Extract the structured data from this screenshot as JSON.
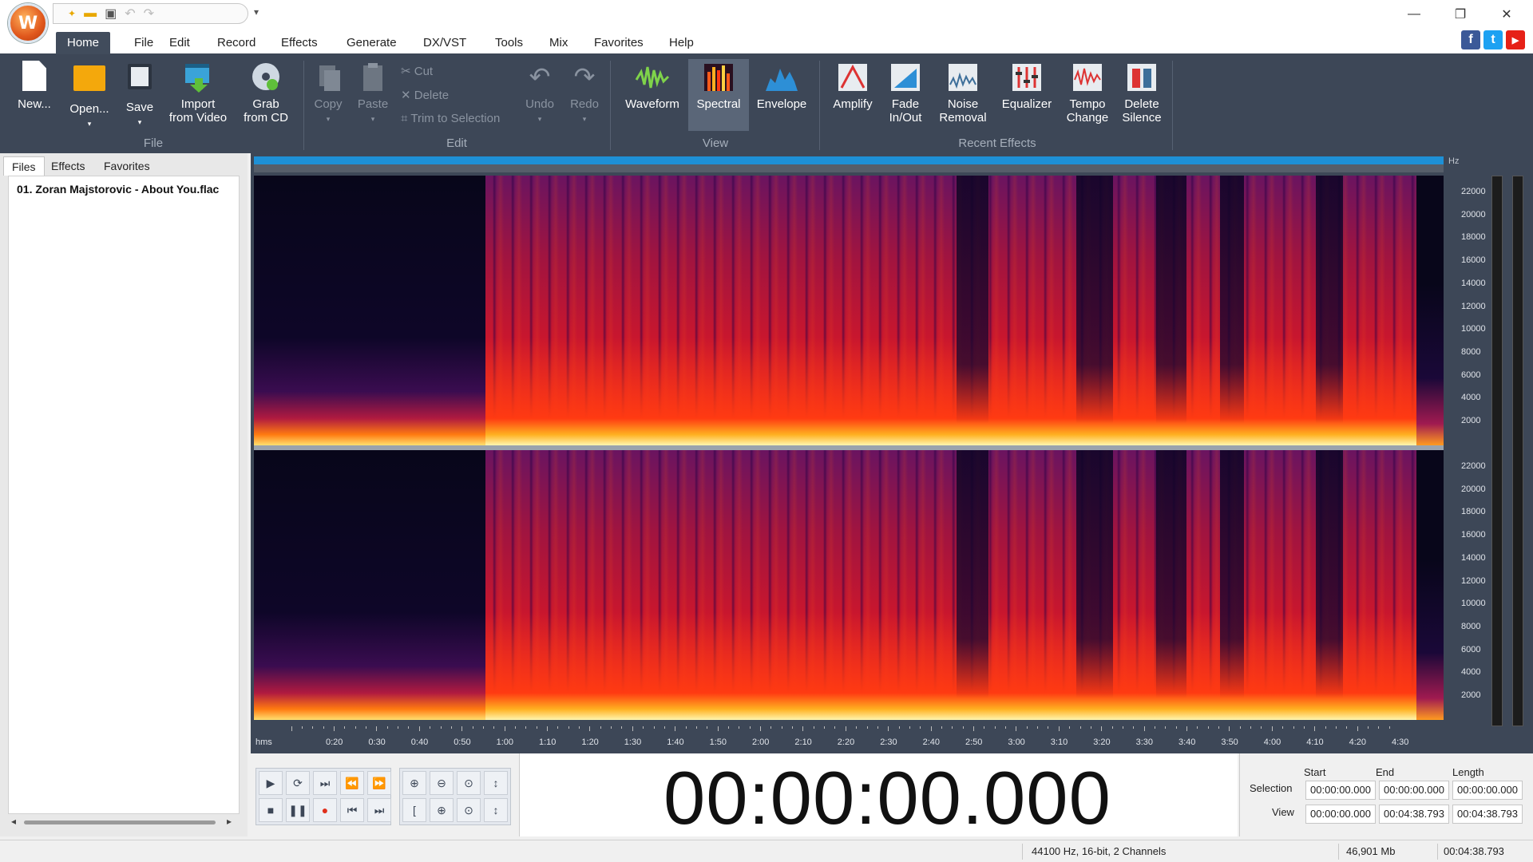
{
  "app": {
    "logo_glyph": "W"
  },
  "quick_access": {
    "new_icon": "new-doc-icon",
    "open_icon": "folder-icon",
    "save_icon": "floppy-icon",
    "undo_icon": "undo-icon",
    "redo_icon": "redo-icon"
  },
  "window_controls": {
    "minimize": "—",
    "restore": "❐",
    "close": "✕"
  },
  "menu": {
    "tabs": [
      "Home",
      "File",
      "Edit",
      "Record",
      "Effects",
      "Generate",
      "DX/VST",
      "Tools",
      "Mix",
      "Favorites",
      "Help"
    ],
    "active": "Home"
  },
  "social": {
    "facebook": "f",
    "twitter": "t",
    "youtube": "▶"
  },
  "ribbon": {
    "file_group": {
      "label": "File",
      "new": "New...",
      "open": "Open...",
      "save": "Save",
      "import_line1": "Import",
      "import_line2": "from Video",
      "grab_line1": "Grab",
      "grab_line2": "from CD"
    },
    "edit_group": {
      "label": "Edit",
      "copy": "Copy",
      "paste": "Paste",
      "cut": "Cut",
      "delete": "Delete",
      "trim": "Trim to Selection",
      "undo": "Undo",
      "redo": "Redo"
    },
    "view_group": {
      "label": "View",
      "waveform": "Waveform",
      "spectral": "Spectral",
      "envelope": "Envelope"
    },
    "effects_group": {
      "label": "Recent Effects",
      "amplify": "Amplify",
      "fade_line1": "Fade",
      "fade_line2": "In/Out",
      "noise_line1": "Noise",
      "noise_line2": "Removal",
      "equalizer": "Equalizer",
      "tempo_line1": "Tempo",
      "tempo_line2": "Change",
      "silence_line1": "Delete",
      "silence_line2": "Silence"
    }
  },
  "left_panel": {
    "tabs": [
      "Files",
      "Effects",
      "Favorites"
    ],
    "active_tab": "Files",
    "files": [
      "01. Zoran Majstorovic - About You.flac"
    ]
  },
  "spectrogram": {
    "hz_unit": "Hz",
    "hz_labels": [
      "22000",
      "20000",
      "18000",
      "16000",
      "14000",
      "12000",
      "10000",
      "8000",
      "6000",
      "4000",
      "2000"
    ],
    "time_unit": "hms",
    "time_labels": [
      "0:20",
      "0:30",
      "0:40",
      "0:50",
      "1:00",
      "1:10",
      "1:20",
      "1:30",
      "1:40",
      "1:50",
      "2:00",
      "2:10",
      "2:20",
      "2:30",
      "2:40",
      "2:50",
      "3:00",
      "3:10",
      "3:20",
      "3:30",
      "3:40",
      "3:50",
      "4:00",
      "4:10",
      "4:20",
      "4:30"
    ]
  },
  "transport": {
    "row1": [
      "▶",
      "⟳",
      "⏭",
      "⏪",
      "⏩"
    ],
    "row1_icons": [
      "play-icon",
      "loop-icon",
      "play-to-end-icon",
      "rewind-icon",
      "fast-forward-icon"
    ],
    "row2": [
      "■",
      "❚❚",
      "●",
      "⏮",
      "⏭"
    ],
    "row2_icons": [
      "stop-icon",
      "pause-icon",
      "record-icon",
      "go-to-start-icon",
      "go-to-end-icon"
    ],
    "zoom_row1": [
      "⊕",
      "⊖",
      "⊙",
      "↕"
    ],
    "zoom_row1_icons": [
      "zoom-in-icon",
      "zoom-out-icon",
      "zoom-full-icon",
      "zoom-vertical-icon"
    ],
    "zoom_row2": [
      "[",
      "⊕",
      "⊙",
      "↕"
    ],
    "zoom_row2_icons": [
      "zoom-selection-icon",
      "zoom-in-vertical-icon",
      "zoom-fit-icon",
      "zoom-vertical-out-icon"
    ]
  },
  "time_display": "00:00:00.000",
  "selection_panel": {
    "headers": {
      "start": "Start",
      "end": "End",
      "length": "Length"
    },
    "selection": {
      "label": "Selection",
      "start": "00:00:00.000",
      "end": "00:00:00.000",
      "length": "00:00:00.000"
    },
    "view": {
      "label": "View",
      "start": "00:00:00.000",
      "end": "00:04:38.793",
      "length": "00:04:38.793"
    }
  },
  "status": {
    "format": "44100 Hz, 16-bit, 2 Channels",
    "size": "46,901 Mb",
    "duration": "00:04:38.793"
  },
  "colors": {
    "ribbon": "#3d4757",
    "accent_blue": "#1e90d6",
    "spectral_hot": "#ff3a12"
  }
}
